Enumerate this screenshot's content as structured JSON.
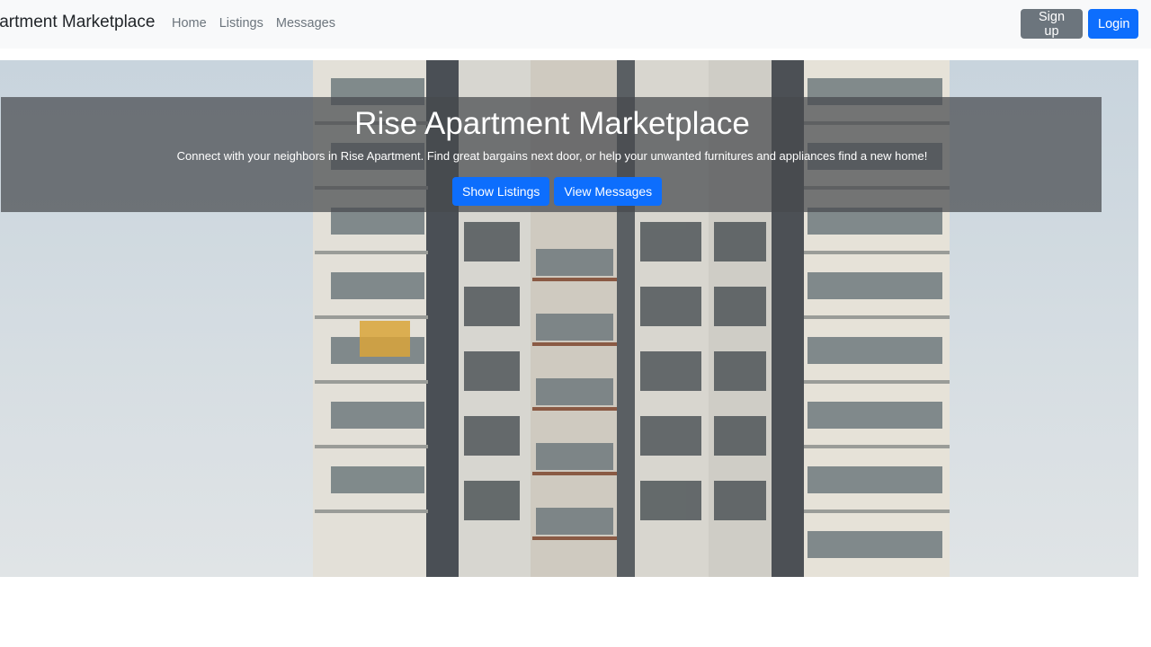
{
  "navbar": {
    "brand": "Apartment Marketplace",
    "links": [
      "Home",
      "Listings",
      "Messages"
    ],
    "signup_label": "Sign up",
    "login_label": "Login"
  },
  "hero": {
    "title": "Rise Apartment Marketplace",
    "subtitle": "Connect with your neighbors in Rise Apartment. Find great bargains next door, or help your unwanted furnitures and appliances find a new home!",
    "show_listings_label": "Show Listings",
    "view_messages_label": "View Messages",
    "image_subject": "apartment-building-photo"
  },
  "colors": {
    "primary": "#0d6efd",
    "secondary": "#6c757d",
    "navbar_bg": "#f8f9fa"
  }
}
